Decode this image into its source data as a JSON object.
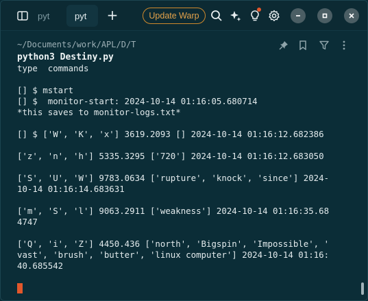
{
  "colors": {
    "background": "#0b2d37",
    "accent_orange": "#e2572b",
    "update_border": "#d08a2c",
    "text": "#e2eaec",
    "muted": "#9db0b6"
  },
  "tabs": [
    {
      "label": "pyt",
      "active": false
    },
    {
      "label": "pyt",
      "active": true
    }
  ],
  "toolbar": {
    "update_label": "Update Warp",
    "icons": [
      "split-panes-icon",
      "new-tab-icon",
      "search-icon",
      "sparkle-ai-icon",
      "lightbulb-icon",
      "gear-icon",
      "minimize-icon",
      "maximize-icon",
      "close-icon"
    ]
  },
  "block": {
    "path": "~/Documents/work/APL/D/T",
    "command": "python3 Destiny.py"
  },
  "output_lines": [
    "type  commands",
    "",
    "[] $ mstart",
    "[] $  monitor-start: 2024-10-14 01:16:05.680714",
    "*this saves to monitor-logs.txt*",
    "",
    "[] $ ['W', 'K', 'x'] 3619.2093 [] 2024-10-14 01:16:12.682386",
    "",
    "['z', 'n', 'h'] 5335.3295 ['720'] 2024-10-14 01:16:12.683050",
    "",
    "['S', 'U', 'W'] 9783.0634 ['rupture', 'knock', 'since'] 2024-",
    "10-14 01:16:14.683631",
    "",
    "['m', 'S', 'l'] 9063.2911 ['weakness'] 2024-10-14 01:16:35.68",
    "4747",
    "",
    "['Q', 'i', 'Z'] 4450.436 ['north', 'Bigspin', 'Impossible', '",
    "vast', 'brush', 'butter', 'linux computer'] 2024-10-14 01:16:",
    "40.685542"
  ]
}
